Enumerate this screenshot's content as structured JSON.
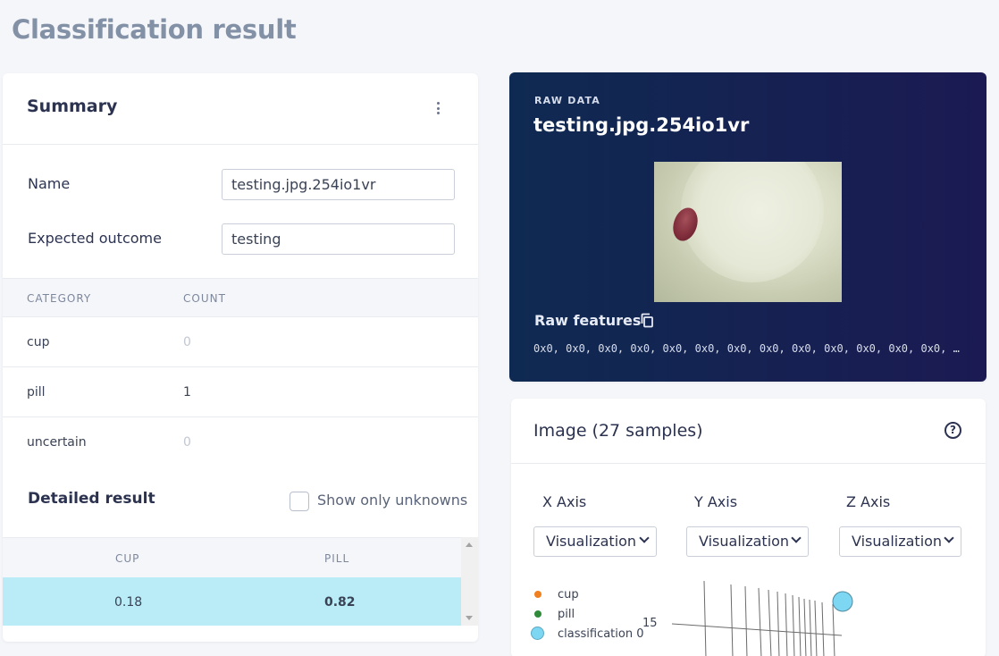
{
  "page": {
    "title": "Classification result"
  },
  "summary": {
    "title": "Summary",
    "name_label": "Name",
    "name_value": "testing.jpg.254io1vr",
    "expected_label": "Expected outcome",
    "expected_value": "testing",
    "table": {
      "headers": [
        "CATEGORY",
        "COUNT"
      ],
      "rows": [
        {
          "category": "cup",
          "count": "0"
        },
        {
          "category": "pill",
          "count": "1"
        },
        {
          "category": "uncertain",
          "count": "0"
        }
      ]
    },
    "detailed_title": "Detailed result",
    "show_unknowns_label": "Show only unknowns",
    "result": {
      "headers": [
        "CUP",
        "PILL"
      ],
      "rows": [
        {
          "cup": "0.18",
          "pill": "0.82"
        }
      ]
    }
  },
  "raw_data": {
    "overline": "RAW DATA",
    "title": "testing.jpg.254io1vr",
    "features_label": "Raw features",
    "features_values": "0x0, 0x0, 0x0, 0x0, 0x0, 0x0, 0x0, 0x0, 0x0, 0x0, 0x0, 0x0, 0x0, 0x0, 0x0, 0x0"
  },
  "image_panel": {
    "title": "Image (27 samples)",
    "help": "?",
    "x_axis_label": "X Axis",
    "y_axis_label": "Y Axis",
    "z_axis_label": "Z Axis",
    "x_axis_value": "Visualization",
    "y_axis_value": "Visualization",
    "z_axis_value": "Visualization",
    "legend": [
      {
        "label": "cup",
        "color": "#f07f1e"
      },
      {
        "label": "pill",
        "color": "#2f8a3a"
      },
      {
        "label": "classification 0",
        "color": "#7dd6f2"
      }
    ],
    "tick_15": "15"
  },
  "colors": {
    "accent_row": "#b9ecf7",
    "raw_bg_start": "#0f2a52",
    "raw_bg_end": "#1b1a52",
    "title_gray": "#8391a7"
  },
  "icons": [
    "kebab-menu-icon",
    "copy-icon",
    "help-icon",
    "chevron-down-icon"
  ]
}
